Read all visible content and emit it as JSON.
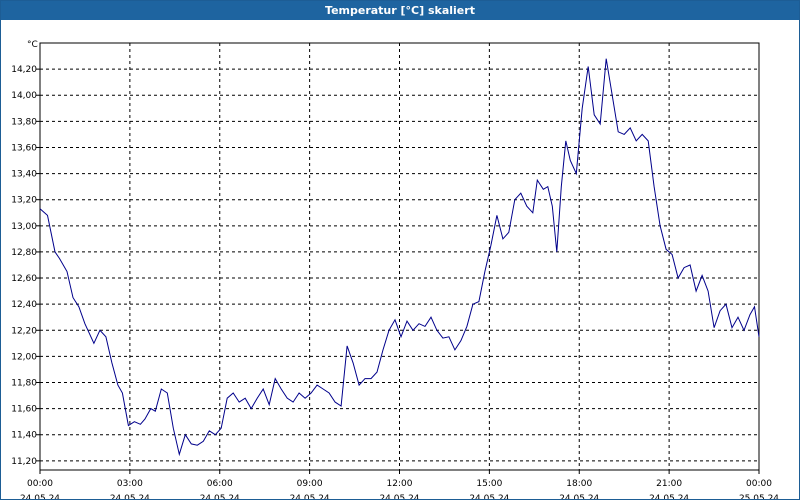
{
  "window": {
    "title": "Temperatur [°C] skaliert"
  },
  "colors": {
    "titlebar": "#1e64a0",
    "line": "#00008b",
    "grid": "#000000"
  },
  "chart_data": {
    "type": "line",
    "ylabel": "°C",
    "ylim": [
      11.13,
      14.4
    ],
    "y_ticks": [
      "11,20",
      "11,40",
      "11,60",
      "11,80",
      "12,00",
      "12,20",
      "12,40",
      "12,60",
      "12,80",
      "13,00",
      "13,20",
      "13,40",
      "13,60",
      "13,80",
      "14,00",
      "14,20"
    ],
    "y_tick_values": [
      11.2,
      11.4,
      11.6,
      11.8,
      12.0,
      12.2,
      12.4,
      12.6,
      12.8,
      13.0,
      13.2,
      13.4,
      13.6,
      13.8,
      14.0,
      14.2
    ],
    "xlim": [
      "24.05.24 00:00",
      "25.05.24 00:00"
    ],
    "x_tick_hours": [
      0,
      3,
      6,
      9,
      12,
      15,
      18,
      21,
      24
    ],
    "x_ticks": [
      {
        "time": "00:00",
        "date": "24.05.24"
      },
      {
        "time": "03:00",
        "date": "24.05.24"
      },
      {
        "time": "06:00",
        "date": "24.05.24"
      },
      {
        "time": "09:00",
        "date": "24.05.24"
      },
      {
        "time": "12:00",
        "date": "24.05.24"
      },
      {
        "time": "15:00",
        "date": "24.05.24"
      },
      {
        "time": "18:00",
        "date": "24.05.24"
      },
      {
        "time": "21:00",
        "date": "24.05.24"
      },
      {
        "time": "00:00",
        "date": "25.05.24"
      }
    ],
    "grid": true,
    "series": [
      {
        "x_hours": [
          0,
          0.25,
          0.5,
          0.65,
          0.9,
          1.1,
          1.3,
          1.5,
          1.8,
          2.0,
          2.2,
          2.4,
          2.6,
          2.75,
          2.95,
          3.15,
          3.35,
          3.5,
          3.7,
          3.85,
          4.05,
          4.25,
          4.45,
          4.65,
          4.85,
          5.05,
          5.25,
          5.45,
          5.65,
          5.85,
          6.05,
          6.25,
          6.45,
          6.65,
          6.85,
          7.05,
          7.25,
          7.45,
          7.65,
          7.85,
          8.05,
          8.25,
          8.45,
          8.65,
          8.85,
          9.05,
          9.25,
          9.45,
          9.65,
          9.85,
          10.05,
          10.25,
          10.45,
          10.65,
          10.85,
          11.05,
          11.25,
          11.45,
          11.65,
          11.85,
          12.05,
          12.25,
          12.45,
          12.65,
          12.85,
          13.05,
          13.25,
          13.45,
          13.65,
          13.85,
          14.05,
          14.25,
          14.45,
          14.65,
          14.85,
          15.05,
          15.25,
          15.45,
          15.65,
          15.85,
          16.05,
          16.25,
          16.45,
          16.6,
          16.8,
          16.95,
          17.1,
          17.25,
          17.4,
          17.55,
          17.7,
          17.9,
          18.1,
          18.3,
          18.5,
          18.7,
          18.9,
          19.1,
          19.3,
          19.5,
          19.7,
          19.9,
          20.1,
          20.3,
          20.5,
          20.7,
          20.9,
          21.1,
          21.3,
          21.5,
          21.7,
          21.9,
          22.1,
          22.3,
          22.5,
          22.7,
          22.9,
          23.1,
          23.3,
          23.5,
          23.7,
          23.85,
          24.0
        ],
        "values": [
          13.13,
          13.08,
          12.8,
          12.75,
          12.65,
          12.45,
          12.38,
          12.25,
          12.1,
          12.2,
          12.15,
          11.95,
          11.78,
          11.72,
          11.47,
          11.5,
          11.48,
          11.52,
          11.6,
          11.58,
          11.75,
          11.72,
          11.45,
          11.25,
          11.4,
          11.33,
          11.32,
          11.35,
          11.43,
          11.4,
          11.45,
          11.68,
          11.72,
          11.65,
          11.68,
          11.6,
          11.68,
          11.75,
          11.63,
          11.83,
          11.75,
          11.68,
          11.65,
          11.72,
          11.68,
          11.72,
          11.78,
          11.75,
          11.72,
          11.65,
          11.62,
          12.08,
          11.95,
          11.78,
          11.83,
          11.83,
          11.88,
          12.05,
          12.2,
          12.28,
          12.15,
          12.27,
          12.2,
          12.25,
          12.23,
          12.3,
          12.2,
          12.14,
          12.15,
          12.05,
          12.12,
          12.23,
          12.4,
          12.42,
          12.65,
          12.85,
          13.08,
          12.9,
          12.95,
          13.2,
          13.25,
          13.15,
          13.1,
          13.35,
          13.28,
          13.3,
          13.15,
          12.8,
          13.3,
          13.65,
          13.5,
          13.4,
          13.9,
          14.22,
          13.85,
          13.78,
          14.28,
          14.0,
          13.72,
          13.7,
          13.75,
          13.65,
          13.7,
          13.65,
          13.3,
          13.0,
          12.82,
          12.78,
          12.6,
          12.68,
          12.7,
          12.5,
          12.62,
          12.5,
          12.22,
          12.35,
          12.4,
          12.22,
          12.3,
          12.2,
          12.32,
          12.38,
          12.15,
          12.3,
          12.28,
          12.35,
          12.4
        ],
        "note": ""
      }
    ]
  }
}
